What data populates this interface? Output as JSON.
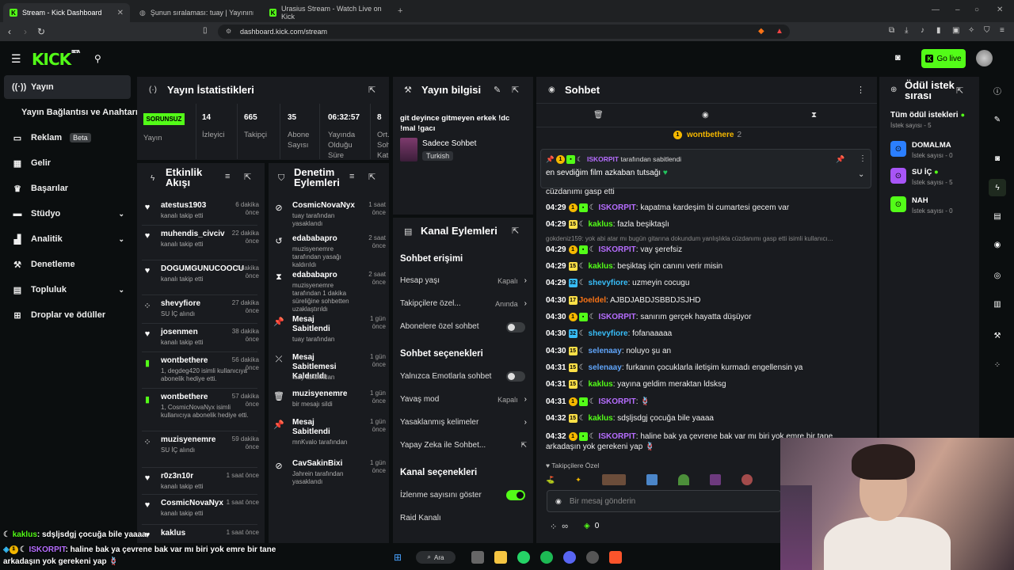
{
  "browser": {
    "tabs": [
      {
        "title": "Stream - Kick Dashboard",
        "active": true
      },
      {
        "title": "Şunun sıralaması: tuay | Yayınını güçl...",
        "active": false
      },
      {
        "title": "Urasius Stream - Watch Live on Kick",
        "active": false
      }
    ],
    "url": "dashboard.kick.com/stream"
  },
  "header": {
    "logo": "KICK",
    "logo_sup": "BETA",
    "go_live": "Go live"
  },
  "sidebar": {
    "items": [
      {
        "label": "Yayın",
        "icon": "broadcast-icon",
        "active": true
      },
      {
        "label": "Yayın Bağlantısı ve Anahtarı",
        "icon": "",
        "active": false
      },
      {
        "label": "Reklam",
        "icon": "ad-icon",
        "badge": "Beta"
      },
      {
        "label": "Gelir",
        "icon": "revenue-icon"
      },
      {
        "label": "Başarılar",
        "icon": "trophy-icon"
      },
      {
        "label": "Stüdyo",
        "icon": "studio-icon",
        "chevron": true
      },
      {
        "label": "Analitik",
        "icon": "chart-icon",
        "chevron": true
      },
      {
        "label": "Denetleme",
        "icon": "wrench-icon"
      },
      {
        "label": "Topluluk",
        "icon": "community-icon",
        "chevron": true
      },
      {
        "label": "Droplar ve ödüller",
        "icon": "drops-icon"
      }
    ]
  },
  "stats": {
    "title": "Yayın İstatistikleri",
    "status": "SORUNSUZ",
    "status_label": "Yayın",
    "items": [
      {
        "value": "14",
        "label": "İzleyici"
      },
      {
        "value": "665",
        "label": "Takipçi"
      },
      {
        "value": "35",
        "label": "Abone Sayısı"
      },
      {
        "value": "06:32:57",
        "label": "Yayında Olduğu Süre"
      },
      {
        "value": "8",
        "label": "Ort. Sohbet Katılımı"
      }
    ]
  },
  "stream_info": {
    "title": "Yayın bilgisi",
    "stream_title": "git deyince gitmeyen erkek !dc !mal !gacı",
    "category": "Sadece Sohbet",
    "language": "Turkish"
  },
  "activity": {
    "title": "Etkinlik Akışı",
    "items": [
      {
        "name": "atestus1903",
        "time": "6 dakika önce",
        "desc": "kanalı takip etti",
        "icon": "heart"
      },
      {
        "name": "muhendis_civciv",
        "time": "22 dakika önce",
        "desc": "kanalı takip etti",
        "icon": "heart"
      },
      {
        "name": "DOGUMGUNUCOOCU",
        "time": "2 dakika önce",
        "desc": "kanalı takip etti",
        "icon": "heart"
      },
      {
        "name": "shevyfiore",
        "time": "27 dakika önce",
        "desc": "SU İÇ alındı",
        "icon": "drops"
      },
      {
        "name": "josenmen",
        "time": "38 dakika önce",
        "desc": "kanalı takip etti",
        "icon": "heart"
      },
      {
        "name": "wontbethere",
        "time": "56 dakika önce",
        "desc": "1, degdeg420 isimli kullanıcıya abonelik hediye etti.",
        "icon": "gift"
      },
      {
        "name": "wontbethere",
        "time": "57 dakika önce",
        "desc": "1, CosmicNovaNyx isimli kullanıcıya abonelik hediye etti.",
        "icon": "gift"
      },
      {
        "name": "muzisyenemre",
        "time": "59 dakika önce",
        "desc": "SU İÇ alındı",
        "icon": "drops"
      },
      {
        "name": "r0z3n10r",
        "time": "1 saat önce",
        "desc": "kanalı takip etti",
        "icon": "heart"
      },
      {
        "name": "CosmicNovaNyx",
        "time": "1 saat önce",
        "desc": "kanalı takip etti",
        "icon": "heart"
      },
      {
        "name": "kaklus",
        "time": "1 saat önce",
        "desc": "",
        "icon": "heart"
      }
    ]
  },
  "moderation": {
    "title": "Denetim Eylemleri",
    "items": [
      {
        "name": "CosmicNovaNyx",
        "time": "1 saat önce",
        "desc": "tuay tarafından yasaklandı",
        "icon": "ban"
      },
      {
        "name": "edababapro",
        "time": "2 saat önce",
        "desc": "muzisyenemre tarafından yasağı kaldırıldı",
        "icon": "undo"
      },
      {
        "name": "edababapro",
        "time": "2 saat önce",
        "desc": "muzisyenemre tarafından 1 dakika süreliğine sohbetten uzaklaştırıldı",
        "icon": "hourglass"
      },
      {
        "name": "Mesaj Sabitlendi",
        "time": "1 gün önce",
        "desc": "tuay tarafından",
        "icon": "pin"
      },
      {
        "name": "Mesaj Sabitlemesi Kaldırıldı",
        "time": "1 gün önce",
        "desc": "tuay tarafından",
        "icon": "unpin"
      },
      {
        "name": "muzisyenemre",
        "time": "1 gün önce",
        "desc": "bir mesajı sildi",
        "icon": "trash"
      },
      {
        "name": "Mesaj Sabitlendi",
        "time": "1 gün önce",
        "desc": "mnKvalo tarafından",
        "icon": "pin"
      },
      {
        "name": "CavSakinBixi",
        "time": "1 gün önce",
        "desc": "Jahrein tarafından yasaklandı",
        "icon": "ban"
      }
    ]
  },
  "channel_actions": {
    "title": "Kanal Eylemleri",
    "chat_access": "Sohbet erişimi",
    "account_age": {
      "label": "Hesap yaşı",
      "value": "Kapalı"
    },
    "followers_only": {
      "label": "Takipçilere özel...",
      "value": "Anında"
    },
    "subs_only": {
      "label": "Abonelere özel sohbet",
      "on": false
    },
    "chat_options": "Sohbet seçenekleri",
    "emotes_only": {
      "label": "Yalnızca Emotlarla sohbet",
      "on": false
    },
    "slow_mode": {
      "label": "Yavaş mod",
      "value": "Kapalı"
    },
    "banned_words": {
      "label": "Yasaklanmış kelimeler"
    },
    "ai_chat": {
      "label": "Yapay Zeka ile Sohbet..."
    },
    "channel_options": "Kanal seçenekleri",
    "show_viewers": {
      "label": "İzlenme sayısını göster",
      "on": true
    },
    "raid": {
      "label": "Raid Kanalı"
    }
  },
  "chat": {
    "title": "Sohbet",
    "top_gifter": "wontbethere",
    "top_gifter_count": "2",
    "pinned": {
      "by_user": "ISKORPIT",
      "by_suffix": "tarafından sabitlendi",
      "message": "en sevdiğim film azkaban tutsağı"
    },
    "partial_line": "cüzdanımı gasp etti",
    "reply_context": "gokdeniz159: yok abi atar mı bugün gitarına dokundum yanlışlıkla cüzdanımı gasp etti isimli kullanıcı...",
    "messages": [
      {
        "time": "04:29",
        "badges": [
          "gold",
          "green",
          "moon"
        ],
        "user": "ISKORPIT",
        "color": "#b66dff",
        "text": "kapatma kardeşim bi cumartesi gecem var"
      },
      {
        "time": "04:29",
        "badges": [
          "yel15",
          "moon"
        ],
        "user": "kaklus",
        "color": "#53fc18",
        "text": "fazla beşiktaşlı"
      },
      {
        "time": "04:29",
        "badges": [
          "gold",
          "green",
          "moon"
        ],
        "user": "ISKORPIT",
        "color": "#b66dff",
        "text": "vay şerefsiz"
      },
      {
        "time": "04:29",
        "badges": [
          "yel15",
          "moon"
        ],
        "user": "kaklus",
        "color": "#53fc18",
        "text": "beşiktaş için canını verir misin"
      },
      {
        "time": "04:29",
        "badges": [
          "cyan32",
          "moon"
        ],
        "user": "shevyfiore",
        "color": "#38bdf8",
        "text": "uzmeyin cocugu"
      },
      {
        "time": "04:30",
        "badges": [
          "yel17"
        ],
        "user": "Joeldel",
        "color": "#f97316",
        "text": "AJBDJABDJSBBDJSJHD"
      },
      {
        "time": "04:30",
        "badges": [
          "gold",
          "green",
          "moon"
        ],
        "user": "ISKORPIT",
        "color": "#b66dff",
        "text": "sanırım gerçek hayatta düşüyor"
      },
      {
        "time": "04:30",
        "badges": [
          "cyan32",
          "moon"
        ],
        "user": "shevyfiore",
        "color": "#38bdf8",
        "text": "fofanaaaaa"
      },
      {
        "time": "04:30",
        "badges": [
          "yel15",
          "moon"
        ],
        "user": "selenaay",
        "color": "#60a5fa",
        "text": "noluyo şu an"
      },
      {
        "time": "04:31",
        "badges": [
          "yel15",
          "moon"
        ],
        "user": "selenaay",
        "color": "#60a5fa",
        "text": "furkanın çocuklarla iletişim kurmadı engellensin ya"
      },
      {
        "time": "04:31",
        "badges": [
          "yel15",
          "moon"
        ],
        "user": "kaklus",
        "color": "#53fc18",
        "text": "yayına geldim meraktan ldsksg"
      },
      {
        "time": "04:31",
        "badges": [
          "gold",
          "green",
          "moon"
        ],
        "user": "ISKORPIT",
        "color": "#b66dff",
        "text": "🪢"
      },
      {
        "time": "04:32",
        "badges": [
          "yel15",
          "moon"
        ],
        "user": "kaklus",
        "color": "#53fc18",
        "text": "sdşljsdgj çocuğa bile yaaaa"
      },
      {
        "time": "04:32",
        "badges": [
          "gold",
          "green",
          "moon"
        ],
        "user": "ISKORPIT",
        "color": "#b66dff",
        "text": "haline bak ya çevrene bak var mı biri yok emre bir tane arkadaşın yok gerekeni yap 🪢"
      }
    ],
    "followers_only_label": "Takipçilere Özel",
    "input_placeholder": "Bir mesaj gönderin",
    "infinity": "∞",
    "kick_points": "0"
  },
  "rewards": {
    "title": "Ödül istek sırası",
    "all_requests": "Tüm ödül istekleri",
    "all_requests_count": "İstek sayısı - 5",
    "items": [
      {
        "name": "DOMALMA",
        "count": "İstek sayısı - 0",
        "color": "#2b7fff",
        "dot": false
      },
      {
        "name": "SU İÇ",
        "count": "İstek sayısı - 5",
        "color": "#a855f7",
        "dot": true
      },
      {
        "name": "NAH",
        "count": "İstek sayısı - 0",
        "color": "#53fc18",
        "dot": false
      }
    ]
  },
  "overlay": {
    "line1_user": "kaklus",
    "line1_text": ": sdşljsdgj çocuğa bile yaaaa",
    "line2_user": "ISKORPIT",
    "line2_text": ": haline bak ya çevrene bak var mı biri yok emre bir tane",
    "line3_text": "arkadaşın yok gerekeni yap 🪢"
  },
  "taskbar": {
    "search": "Ara"
  }
}
